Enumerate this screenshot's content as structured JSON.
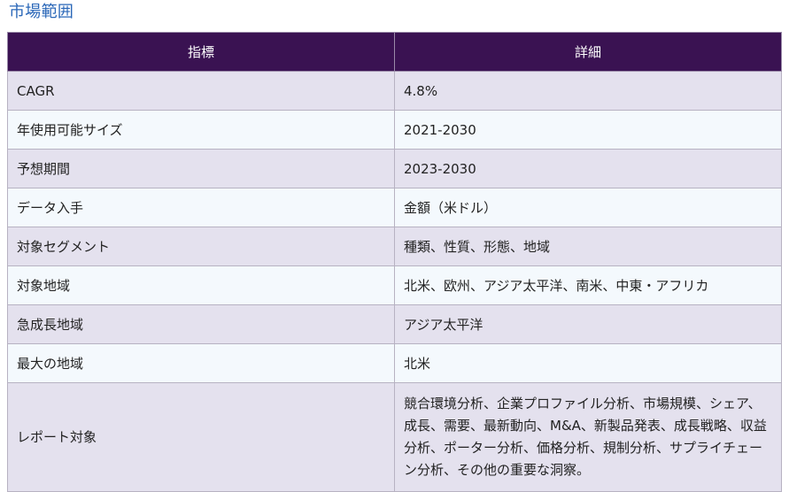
{
  "section": {
    "title": "市場範囲"
  },
  "table": {
    "headers": [
      "指標",
      "詳細"
    ],
    "rows": [
      {
        "label": "CAGR",
        "value": "4.8%"
      },
      {
        "label": "年使用可能サイズ",
        "value": "2021-2030"
      },
      {
        "label": "予想期間",
        "value": "2023-2030"
      },
      {
        "label": "データ入手",
        "value": "金額（米ドル）"
      },
      {
        "label": "対象セグメント",
        "value": "種類、性質、形態、地域"
      },
      {
        "label": "対象地域",
        "value": "北米、欧州、アジア太平洋、南米、中東・アフリカ"
      },
      {
        "label": "急成長地域",
        "value": "アジア太平洋"
      },
      {
        "label": "最大の地域",
        "value": "北米"
      },
      {
        "label": "レポート対象",
        "value": "競合環境分析、企業プロファイル分析、市場規模、シェア、成長、需要、最新動向、M&A、新製品発表、成長戦略、収益分析、ポーター分析、価格分析、規制分析、サプライチェーン分析、その他の重要な洞察。"
      }
    ]
  },
  "colors": {
    "title": "#2a67b8",
    "header_bg": "#3a1252",
    "row_odd": "#e4e1ee",
    "row_even": "#f4f9fd"
  }
}
